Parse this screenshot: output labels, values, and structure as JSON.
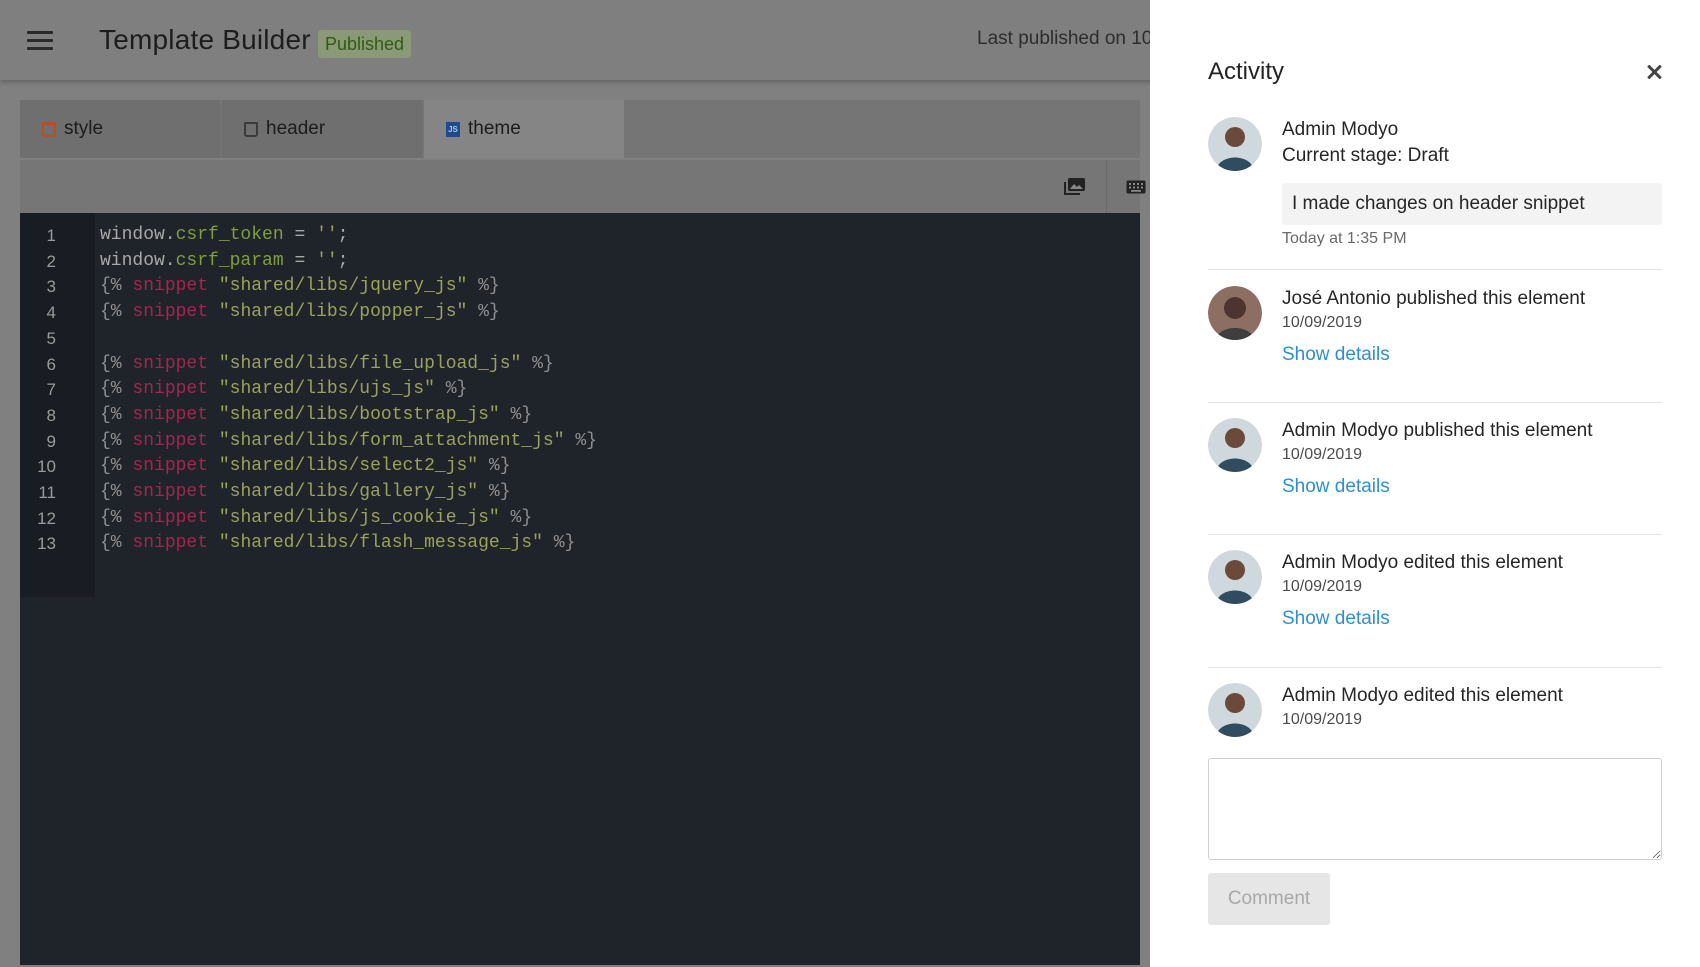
{
  "header": {
    "title": "Template Builder",
    "status_badge": "Published",
    "last_published": "Last published on 10"
  },
  "tabs": [
    {
      "label": "style",
      "icon": "css-file-icon"
    },
    {
      "label": "header",
      "icon": "html-file-icon"
    },
    {
      "label": "theme",
      "icon": "js-file-icon"
    }
  ],
  "toolbar": {
    "buttons": [
      {
        "icon": "media-library-icon"
      },
      {
        "icon": "keyboard-icon"
      }
    ]
  },
  "editor": {
    "line_numbers": [
      "1",
      "2",
      "3",
      "4",
      "5",
      "6",
      "7",
      "8",
      "9",
      "10",
      "11",
      "12",
      "13"
    ],
    "lines": [
      "window.csrf_token = '';",
      "window.csrf_param = '';",
      "{% snippet \"shared/libs/jquery_js\" %}",
      "{% snippet \"shared/libs/popper_js\" %}",
      "",
      "{% snippet \"shared/libs/file_upload_js\" %}",
      "{% snippet \"shared/libs/ujs_js\" %}",
      "{% snippet \"shared/libs/bootstrap_js\" %}",
      "{% snippet \"shared/libs/form_attachment_js\" %}",
      "{% snippet \"shared/libs/select2_js\" %}",
      "{% snippet \"shared/libs/gallery_js\" %}",
      "{% snippet \"shared/libs/js_cookie_js\" %}",
      "{% snippet \"shared/libs/flash_message_js\" %}"
    ]
  },
  "activity": {
    "title": "Activity",
    "entries": [
      {
        "name": "Admin Modyo",
        "stage": "Current stage: Draft",
        "comment": "I made changes on header snippet",
        "time": "Today at 1:35 PM"
      },
      {
        "name": "José Antonio published this element",
        "date": "10/09/2019",
        "details": "Show details"
      },
      {
        "name": "Admin Modyo published this element",
        "date": "10/09/2019",
        "details": "Show details"
      },
      {
        "name": "Admin Modyo edited this element",
        "date": "10/09/2019",
        "details": "Show details"
      },
      {
        "name": "Admin Modyo edited this element",
        "date": "10/09/2019"
      }
    ],
    "comment_placeholder": "",
    "comment_button": "Comment"
  },
  "colors": {
    "link": "#2c8fd6",
    "badge_text": "#305c14",
    "editor_bg": "#1f232a",
    "keyword": "#a4264f",
    "property": "#7f9f3a"
  }
}
